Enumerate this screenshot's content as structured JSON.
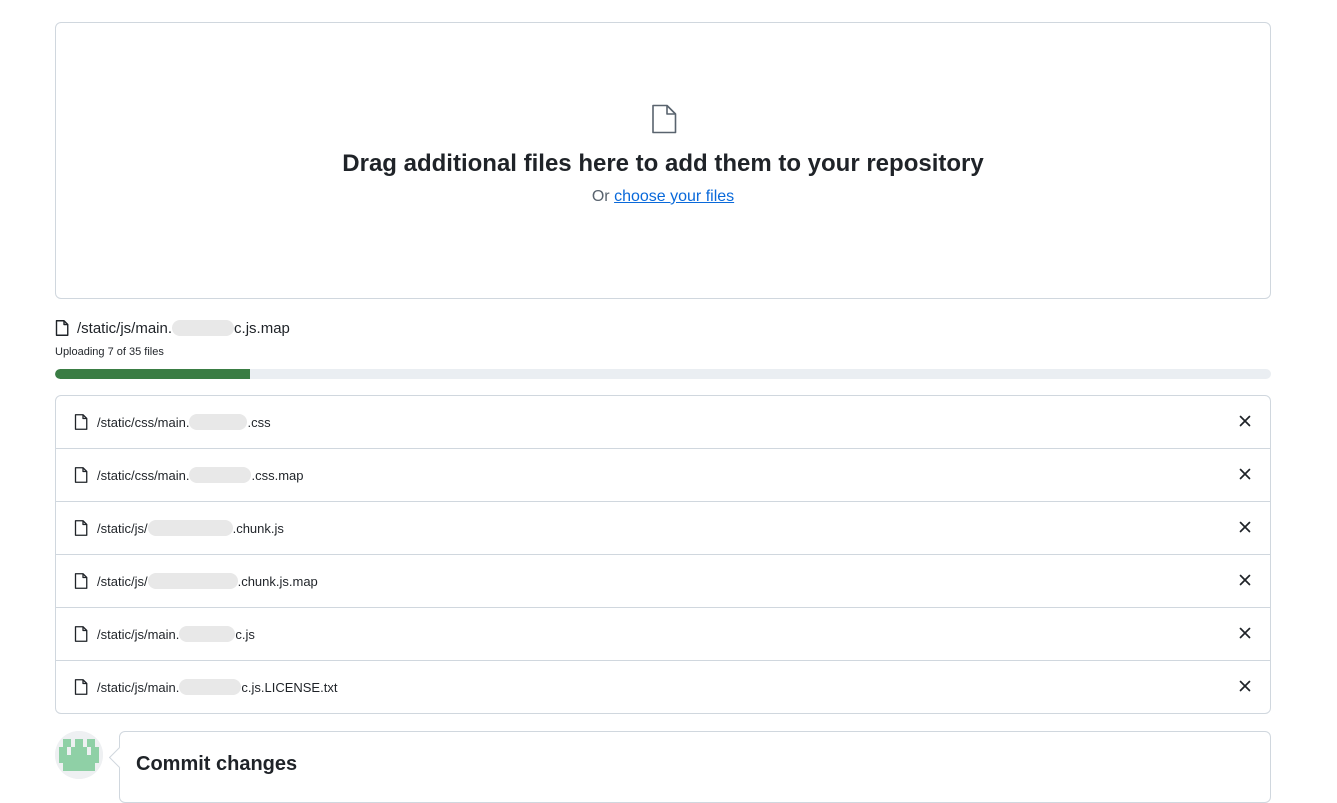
{
  "dropzone": {
    "title": "Drag additional files here to add them to your repository",
    "sub_prefix": "Or ",
    "choose_link": "choose your files"
  },
  "current_upload": {
    "name_prefix": "/static/js/main.",
    "name_suffix": "c.js.map",
    "status": "Uploading 7 of 35 files",
    "progress": 0.16
  },
  "files": [
    {
      "prefix": "/static/css/main.",
      "suffix": ".css"
    },
    {
      "prefix": "/static/css/main.",
      "suffix": ".css.map"
    },
    {
      "prefix": "/static/js/",
      "suffix": ".chunk.js"
    },
    {
      "prefix": "/static/js/",
      "suffix": ".chunk.js.map"
    },
    {
      "prefix": "/static/js/main.",
      "suffix": "c.js"
    },
    {
      "prefix": "/static/js/main.",
      "suffix": "c.js.LICENSE.txt"
    }
  ],
  "commit": {
    "title": "Commit changes"
  },
  "icons": {
    "file": "file-icon",
    "remove": "x-icon"
  },
  "colors": {
    "link": "#0969da",
    "progress": "#3a7d44",
    "border": "#d0d7de"
  }
}
